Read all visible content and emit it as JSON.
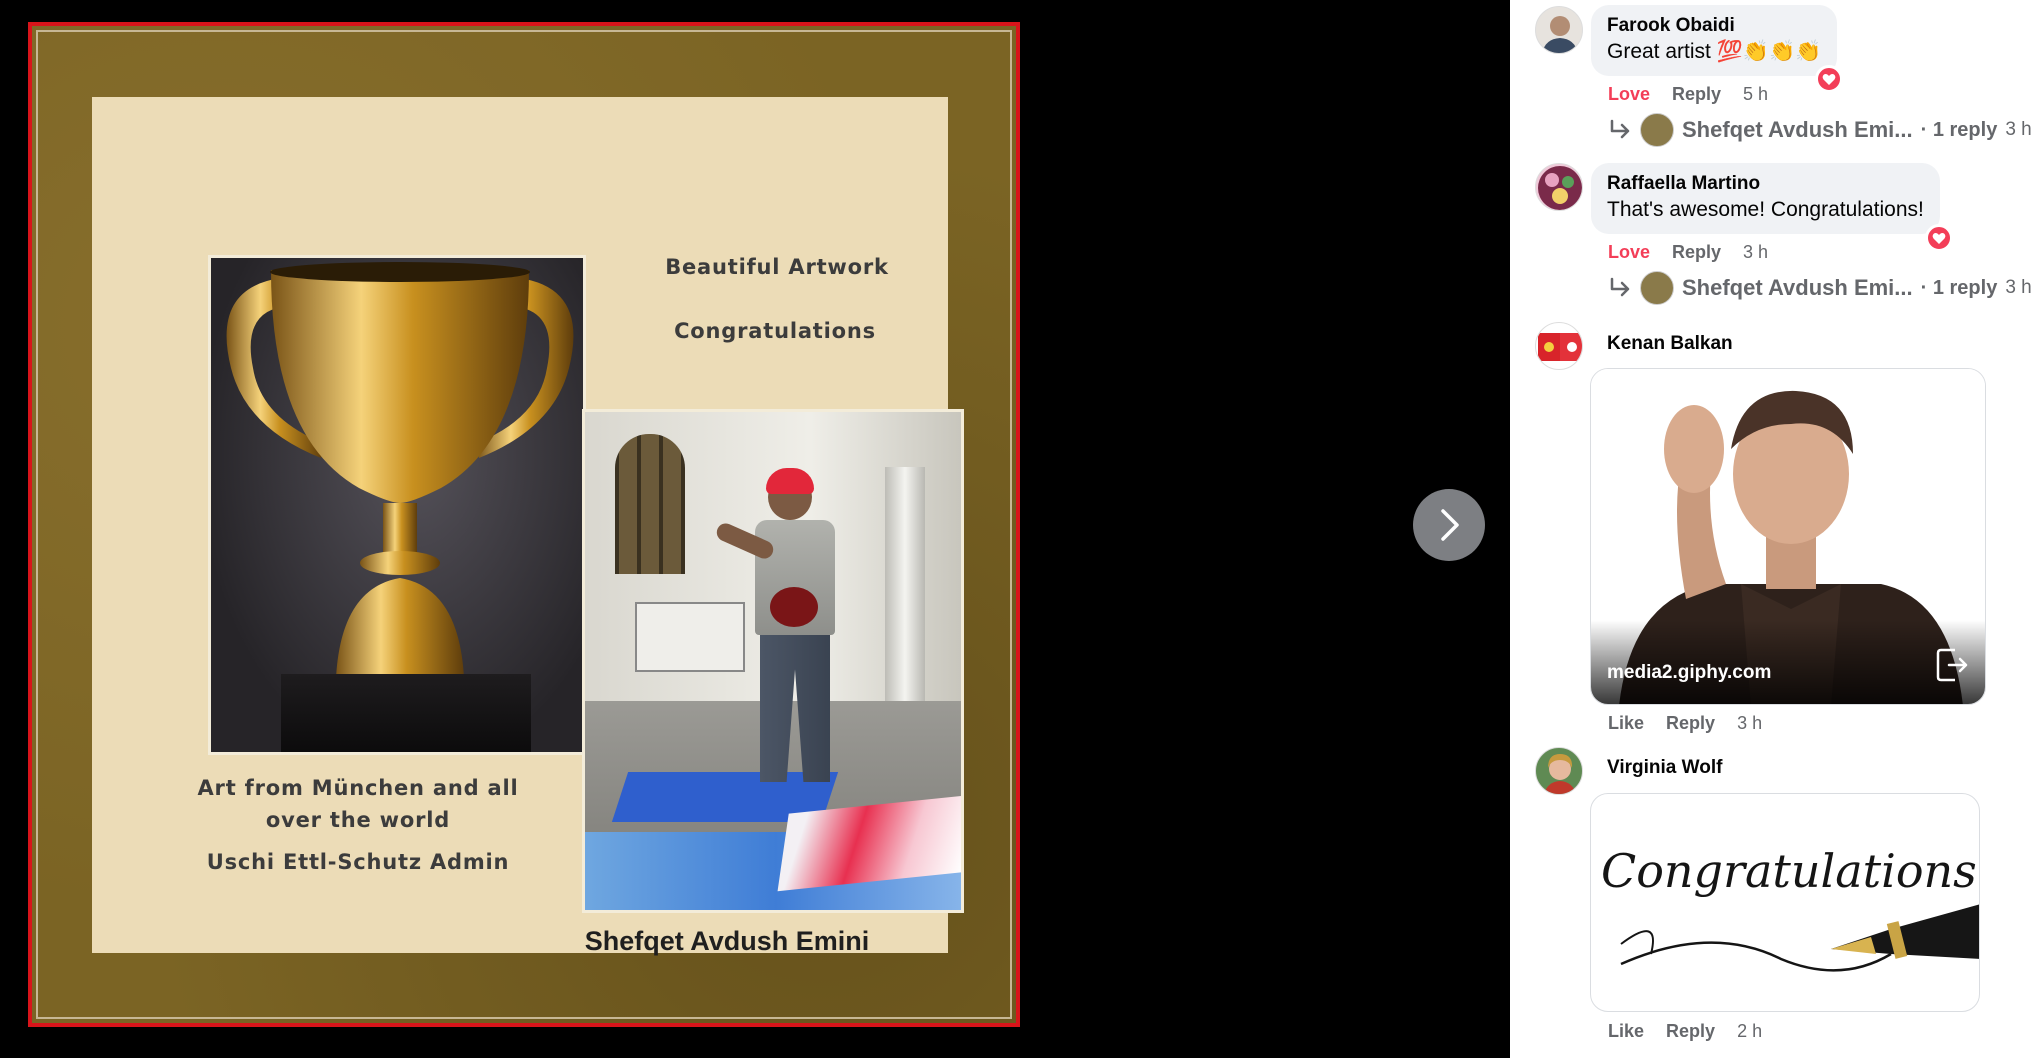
{
  "photo": {
    "heading_1": "Beautiful Artwork",
    "heading_2": "Congratulations",
    "art_line": "Art from Münchеn and all over the world",
    "admin_line": "Uschi Ettl-Schutz Admin",
    "artist_name": "Shefqet Avdush Emini"
  },
  "viewer": {
    "next_icon": "chevron-right-icon"
  },
  "comments": [
    {
      "author": "Farook Obaidi",
      "text": "Great artist 💯👏👏👏",
      "reaction_label": "Love",
      "reply_label": "Reply",
      "time": "5 h",
      "reaction_icon": "heart-icon",
      "replies": {
        "author": "Shefqet Avdush Emi...",
        "count": "· 1 reply",
        "time": "3 h"
      }
    },
    {
      "author": "Raffaella Martino",
      "text": "That's awesome! Congratulations!",
      "reaction_label": "Love",
      "reply_label": "Reply",
      "time": "3 h",
      "reaction_icon": "heart-icon",
      "replies": {
        "author": "Shefqet Avdush Emi...",
        "count": "· 1 reply",
        "time": "3 h"
      }
    },
    {
      "author": "Kenan Balkan",
      "gif_source": "media2.giphy.com",
      "like_label": "Like",
      "reply_label": "Reply",
      "time": "3 h"
    },
    {
      "author": "Virginia Wolf",
      "gif_text": "Congratulations",
      "like_label": "Like",
      "reply_label": "Reply",
      "time": "2 h"
    }
  ],
  "colors": {
    "love": "#f33e58",
    "frame_border": "#d8141a",
    "bubble": "#f0f2f5"
  }
}
